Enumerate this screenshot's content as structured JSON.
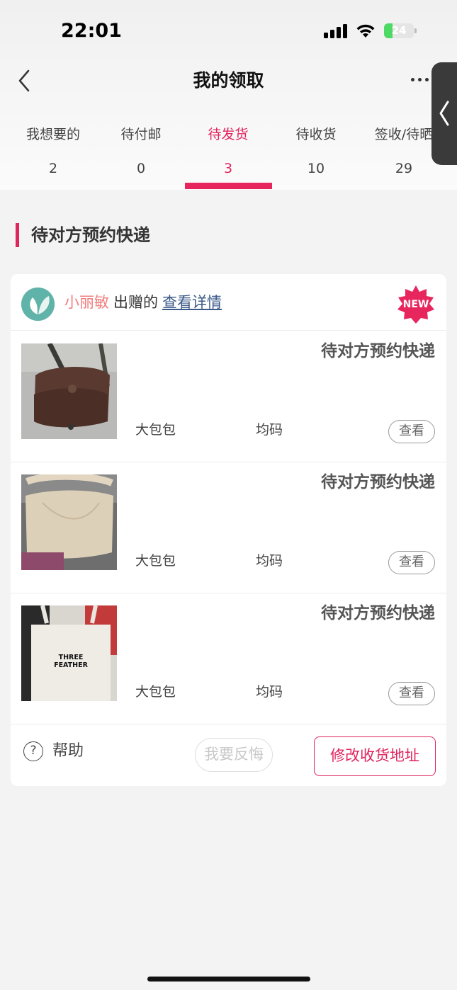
{
  "status_bar": {
    "time": "22:01",
    "battery": "24"
  },
  "header": {
    "title": "我的领取"
  },
  "tabs": [
    {
      "label": "我想要的",
      "count": "2"
    },
    {
      "label": "待付邮",
      "count": "0"
    },
    {
      "label": "待发货",
      "count": "3"
    },
    {
      "label": "待收货",
      "count": "10"
    },
    {
      "label": "签收/待晒",
      "count": "29"
    }
  ],
  "active_tab": 2,
  "section": {
    "title": "待对方预约快递"
  },
  "card": {
    "giver_name": "小丽敏",
    "giver_suffix": "出赠的",
    "detail_link": "查看详情",
    "badge": "NEW",
    "items": [
      {
        "status": "待对方预约快递",
        "name": "大包包",
        "size": "均码",
        "view_label": "查看",
        "thumb": "brown-leather-bag"
      },
      {
        "status": "待对方预约快递",
        "name": "大包包",
        "size": "均码",
        "view_label": "查看",
        "thumb": "beige-canvas-bag"
      },
      {
        "status": "待对方预约快递",
        "name": "大包包",
        "size": "均码",
        "view_label": "查看",
        "thumb": "white-tote-bag",
        "thumb_text": "THREE FEATHER"
      }
    ],
    "footer": {
      "help_icon": "?",
      "help_label": "帮助",
      "regret_label": "我要反悔",
      "address_label": "修改收货地址"
    }
  },
  "colors": {
    "accent": "#e0245e",
    "giver_name": "#f07f7f",
    "link": "#3a5a8a"
  }
}
